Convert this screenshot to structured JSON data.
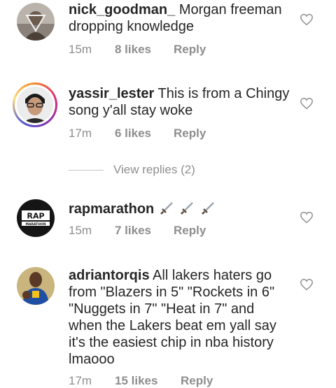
{
  "comments": [
    {
      "username": "nick_goodman_",
      "text": "Morgan freeman dropping knowledge",
      "time": "15m",
      "likes": "8 likes",
      "reply": "Reply",
      "avatar_icon": "person-avatar-icon"
    },
    {
      "username": "yassir_lester",
      "text": "This is from a Chingy song y'all stay woke",
      "time": "17m",
      "likes": "6 likes",
      "reply": "Reply",
      "avatar_icon": "person-avatar-icon",
      "view_replies": "View replies (2)"
    },
    {
      "username": "rapmarathon",
      "text": "",
      "emoji": "dagger-emoji ×3",
      "time": "15m",
      "likes": "7 likes",
      "reply": "Reply",
      "avatar_logo_text": "RAP",
      "avatar_logo_subtext": "MARATHON"
    },
    {
      "username": "adriantorqis",
      "text": "All lakers haters go from \"Blazers in 5\" \"Rockets in 6\" \"Nuggets in 7\" \"Heat in 7\" and when the Lakers beat em yall say it's the easiest chip in nba history lmaooo",
      "time": "17m",
      "likes": "15 likes",
      "reply": "Reply",
      "avatar_icon": "player-avatar-icon"
    }
  ],
  "colors": {
    "text": "#262626",
    "meta": "#8e8e8e",
    "heart_outline": "#8e8e8e"
  }
}
